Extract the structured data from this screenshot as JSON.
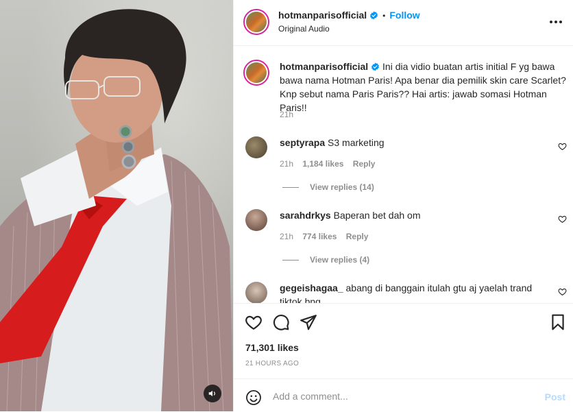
{
  "post": {
    "author": "hotmanparisofficial",
    "follow_label": "Follow",
    "separator": "•",
    "audio_label": "Original Audio",
    "more_icon": "more-horizontal-icon"
  },
  "caption": {
    "username": "hotmanparisofficial",
    "text": "Ini dia vidio buatan artis initial F yg bawa bawa nama Hotman Paris! Apa benar dia pemilik skin care Scarlet? Knp sebut nama Paris Paris?? Hai artis: jawab somasi Hotman Paris!!",
    "time": "21h"
  },
  "comments": [
    {
      "username": "septyrapa",
      "text": "S3 marketing",
      "time": "21h",
      "likes": "1,184 likes",
      "reply": "Reply",
      "view_replies": "View replies (14)"
    },
    {
      "username": "sarahdrkys",
      "text": "Baperan bet dah om",
      "time": "21h",
      "likes": "774 likes",
      "reply": "Reply",
      "view_replies": "View replies (4)"
    },
    {
      "username": "gegeishagaa_",
      "text": "abang di banggain itulah gtu aj yaelah trand tiktok bng"
    }
  ],
  "actions": {
    "likes": "71,301 likes",
    "time_ago": "21 HOURS AGO",
    "icons": [
      "heart-icon",
      "comment-icon",
      "share-icon",
      "bookmark-icon"
    ]
  },
  "composer": {
    "placeholder": "Add a comment...",
    "post_label": "Post"
  },
  "colors": {
    "link": "#0095f6",
    "verified": "#0095f6",
    "muted": "#8e8e8e",
    "post_disabled": "#b3dbff",
    "tie": "#d91a1a",
    "jacket": "#a08585"
  }
}
